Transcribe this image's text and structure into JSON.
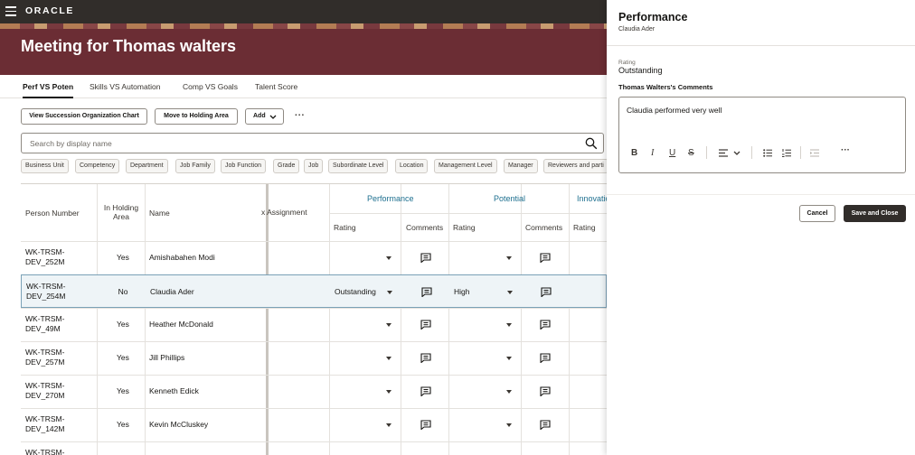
{
  "header": {
    "logo": "ORACLE"
  },
  "banner": {
    "title": "Meeting for Thomas walters"
  },
  "tabs": [
    {
      "label": "Perf VS Poten",
      "active": true
    },
    {
      "label": "Skills VS Automation",
      "active": false
    },
    {
      "label": "Comp VS Goals",
      "active": false
    },
    {
      "label": "Talent Score",
      "active": false
    }
  ],
  "toolbar": {
    "org_chart": "View Succession Organization Chart",
    "holding": "Move to Holding Area",
    "add": "Add",
    "more": "..."
  },
  "search": {
    "placeholder": "Search by display name"
  },
  "filters": [
    "Business Unit",
    "Competency",
    "Department",
    "Job Family",
    "Job Function",
    "Grade",
    "Job",
    "Subordinate Level",
    "Location",
    "Management Level",
    "Manager",
    "Reviewers and parti"
  ],
  "table": {
    "headers": {
      "person_number": "Person Number",
      "holding": "In Holding Area",
      "name": "Name",
      "assignment": "x Assignment",
      "performance": "Performance",
      "potential": "Potential",
      "innovation": "Innovatio",
      "rating": "Rating",
      "comments": "Comments"
    },
    "rows": [
      {
        "pnum1": "WK-TRSM-",
        "pnum2": "DEV_252M",
        "holding": "Yes",
        "name": "Amishabahen Modi",
        "perf": "",
        "pot": ""
      },
      {
        "pnum1": "WK-TRSM-",
        "pnum2": "DEV_254M",
        "holding": "No",
        "name": "Claudia Ader",
        "perf": "Outstanding",
        "pot": "High"
      },
      {
        "pnum1": "WK-TRSM-",
        "pnum2": "DEV_49M",
        "holding": "Yes",
        "name": "Heather McDonald",
        "perf": "",
        "pot": ""
      },
      {
        "pnum1": "WK-TRSM-",
        "pnum2": "DEV_257M",
        "holding": "Yes",
        "name": "Jill Phillips",
        "perf": "",
        "pot": ""
      },
      {
        "pnum1": "WK-TRSM-",
        "pnum2": "DEV_270M",
        "holding": "Yes",
        "name": "Kenneth Edick",
        "perf": "",
        "pot": ""
      },
      {
        "pnum1": "WK-TRSM-",
        "pnum2": "DEV_142M",
        "holding": "Yes",
        "name": "Kevin McCluskey",
        "perf": "",
        "pot": ""
      },
      {
        "pnum1": "WK-TRSM-",
        "pnum2": "",
        "holding": "",
        "name": "",
        "perf": "",
        "pot": ""
      }
    ]
  },
  "drawer": {
    "title": "Performance",
    "subtitle": "Claudia Ader",
    "rating_label": "Rating",
    "rating_value": "Outstanding",
    "comments_label": "Thomas Walters's Comments",
    "comment_text": "Claudia performed very well",
    "cancel": "Cancel",
    "save": "Save and Close"
  }
}
